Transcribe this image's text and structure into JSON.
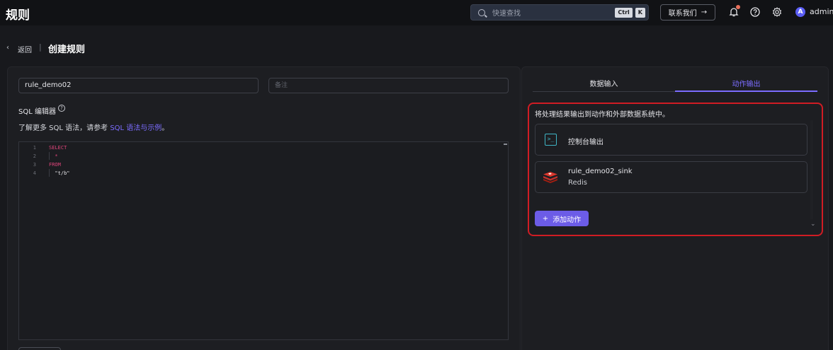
{
  "app": {
    "title": "规则"
  },
  "topbar": {
    "search_placeholder": "快速查找",
    "shortcut_ctrl": "Ctrl",
    "shortcut_k": "K",
    "contact_label": "联系我们",
    "contact_arrow": "→",
    "avatar_letter": "A",
    "username": "admin"
  },
  "breadcrumb": {
    "chevron": "‹",
    "back": "返回",
    "separator": "|",
    "title": "创建规则"
  },
  "form": {
    "rule_name_value": "rule_demo02",
    "note_placeholder": "备注"
  },
  "sql": {
    "label": "SQL 编辑器",
    "help_glyph": "?",
    "hint_prefix": "了解更多 SQL 语法，请参考 ",
    "hint_link": "SQL 语法与示例",
    "hint_suffix": "。",
    "lines": [
      {
        "num": "1",
        "code": "SELECT"
      },
      {
        "num": "2",
        "code": "  *"
      },
      {
        "num": "3",
        "code": "FROM"
      },
      {
        "num": "4",
        "code": "  \"t/b\""
      }
    ]
  },
  "tabs": {
    "input_label": "数据输入",
    "output_label": "动作输出"
  },
  "outputs": {
    "description": "将处理结果输出到动作和外部数据系统中。",
    "items": [
      {
        "title": "控制台输出",
        "icon": "console-icon"
      },
      {
        "title": "rule_demo02_sink",
        "subtitle": "Redis",
        "icon": "redis-icon"
      }
    ],
    "add_label": "添加动作",
    "add_plus": "+"
  },
  "colors": {
    "accent": "#6c5ce7",
    "highlight_border": "#d01c24",
    "keyword": "#e0457b"
  }
}
